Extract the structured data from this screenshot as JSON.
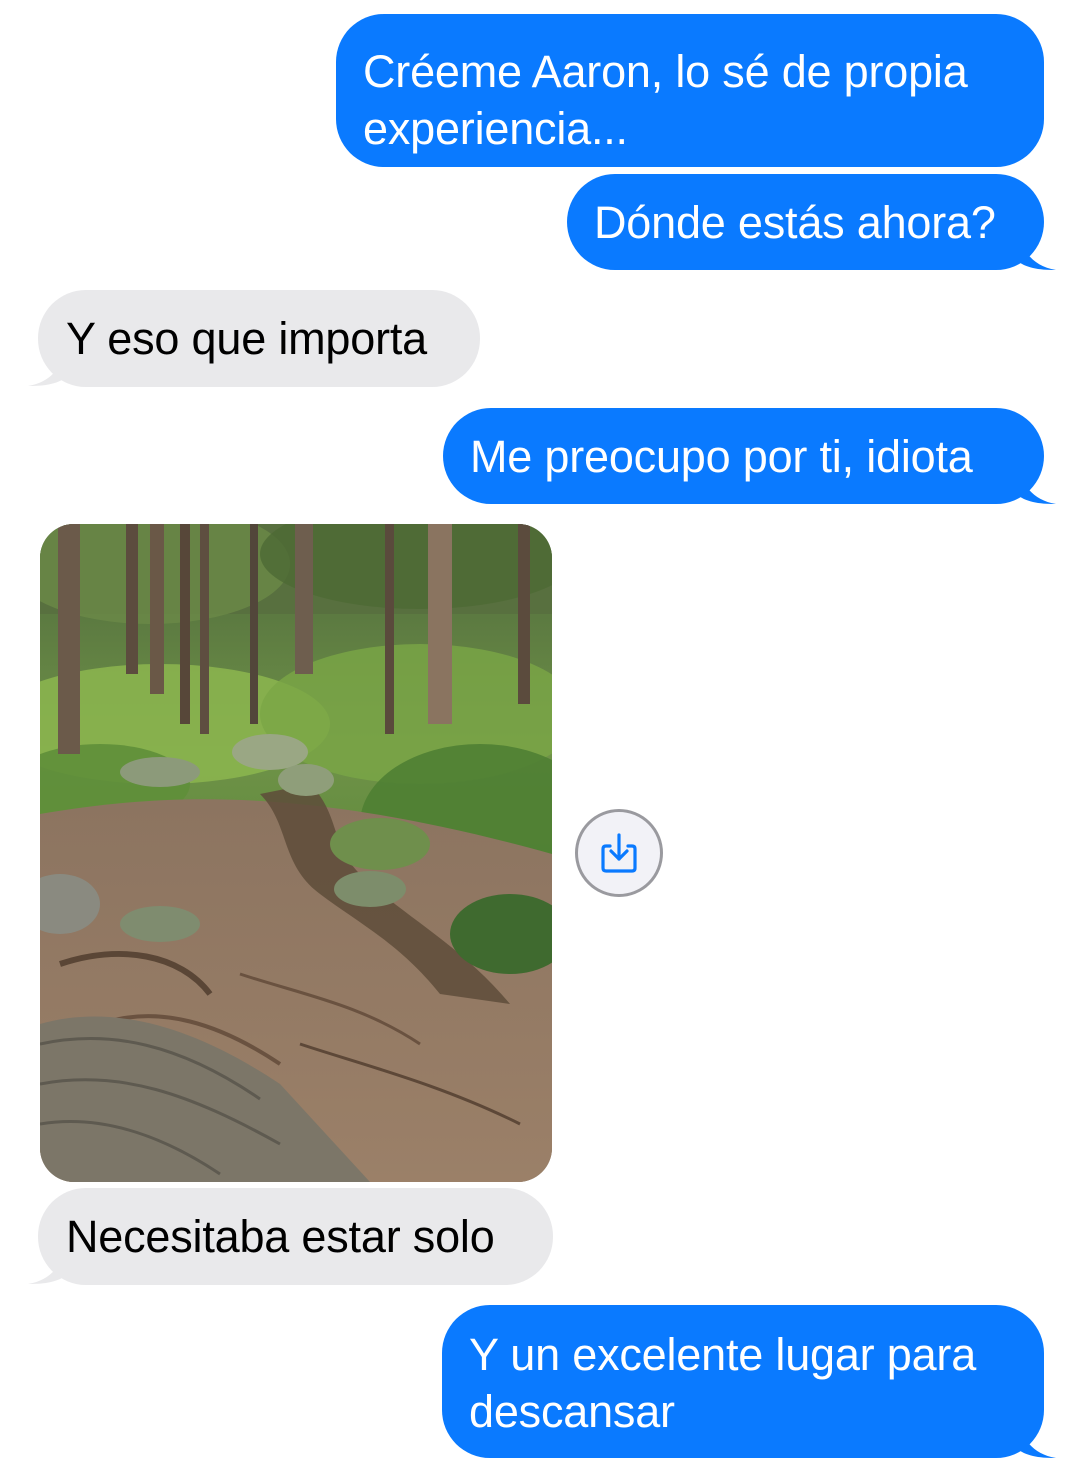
{
  "conversation": {
    "messages": [
      {
        "direction": "sent",
        "type": "text",
        "text": "Créeme Aaron, lo sé de propia experiencia..."
      },
      {
        "direction": "sent",
        "type": "text",
        "text": "Dónde estás ahora?"
      },
      {
        "direction": "received",
        "type": "text",
        "text": "Y eso que importa"
      },
      {
        "direction": "sent",
        "type": "text",
        "text": "Me preocupo por ti, idiota"
      },
      {
        "direction": "received",
        "type": "image",
        "description": "forest-path-photo"
      },
      {
        "direction": "received",
        "type": "text",
        "text": "Necesitaba estar solo"
      },
      {
        "direction": "sent",
        "type": "text",
        "text": "Y un excelente lugar para descansar"
      }
    ]
  },
  "icons": {
    "save_button": "download-icon"
  },
  "colors": {
    "sent_bubble": "#0a7aff",
    "received_bubble": "#e9e9eb",
    "sent_text": "#ffffff",
    "received_text": "#000000"
  }
}
